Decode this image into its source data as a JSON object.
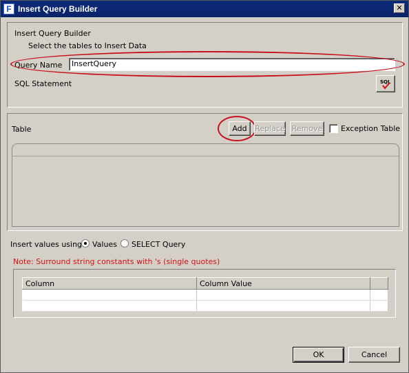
{
  "window": {
    "title": "Insert Query Builder",
    "app_icon_letter": "F",
    "close_glyph": "✕"
  },
  "header": {
    "heading": "Insert Query Builder",
    "subheading": "Select the tables to Insert Data"
  },
  "query": {
    "name_label": "Query Name",
    "name_value": "InsertQuery",
    "sql_label": "SQL Statement",
    "sql_button_icon": "sql-check-icon"
  },
  "table_section": {
    "label": "Table",
    "add_label": "Add",
    "replace_label": "Replace",
    "remove_label": "Remove",
    "exception_label": "Exception Table"
  },
  "insert_values": {
    "label": "Insert values using",
    "option_values": "Values",
    "option_select": "SELECT Query",
    "selected": "Values"
  },
  "note": "Note: Surround string constants with 's (single quotes)",
  "grid": {
    "columns": [
      "Column",
      "Column Value"
    ],
    "rows": [
      [
        "",
        ""
      ],
      [
        "",
        ""
      ]
    ]
  },
  "footer": {
    "ok_label": "OK",
    "cancel_label": "Cancel"
  },
  "colors": {
    "titlebar": "#0a246a",
    "highlight": "#c8101a",
    "note": "#d01010",
    "face": "#d4d0c8"
  }
}
